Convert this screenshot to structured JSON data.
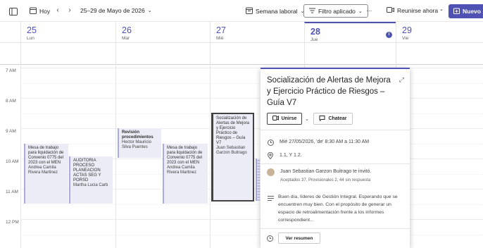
{
  "toolbar": {
    "today_label": "Hoy",
    "date_range": "25–29 de Mayo de 2026",
    "view_label": "Semana laboral",
    "filter_label": "Filtro aplicado",
    "more_label": "···",
    "meet_now_label": "Reunirse ahora",
    "new_label": "Nuevo"
  },
  "days": [
    {
      "num": "25",
      "name": "Lun"
    },
    {
      "num": "26",
      "name": "Mar"
    },
    {
      "num": "27",
      "name": "Mié"
    },
    {
      "num": "28",
      "name": "Jue"
    },
    {
      "num": "29",
      "name": "Vie"
    }
  ],
  "hours": [
    "7 AM",
    "8 AM",
    "9 AM",
    "10 AM",
    "11 AM",
    "12 PM"
  ],
  "events": {
    "mon1": {
      "title": "Mesa de trabajo para liquidación de Convenio 0775 del 2023 con el MEN",
      "people": "Andrea Camila Rivera Martinez"
    },
    "mon2": {
      "title": "AUDITORIA PROCESO PLANEACION ACTAS SEG Y PORSD",
      "people": "Martha Lucia Carb"
    },
    "tue1": {
      "title": "Revisión procedimientos",
      "people": "Hector Mauricio Silva Puentes"
    },
    "tue2": {
      "title": "Mesa de trabajo para liquidación de Convenio 0775 del 2023 con el MEN",
      "people": "Andrea Camila Rivera Martinez"
    },
    "wed1": {
      "title": "Socialización de Alertas de Mejora y Ejercicio Práctico de Riesgos – Guía V7",
      "people": "Juan Sebastian Garzon Buitrago"
    }
  },
  "popup": {
    "title": "Socialización de Alertas de Mejora y Ejercicio Práctico de Riesgos – Guía V7",
    "join_label": "Unirse",
    "chat_label": "Chatear",
    "time": "Mié 27/05/2026, 'de' 8:30 AM a 11:30 AM",
    "location": "1.1, Y 1.2.",
    "organizer": "Juan Sebastian Garzon Buitrago te invitó.",
    "responses": "Aceptados 37, Provisionales 2, 44 sin respuesta",
    "description": "Buen día, líderes de Gestión Integral. Esperando que se encuentren muy bien. Con el propósito de generar un espacio de retroalimentación frente a los informes correspondient...",
    "summary_label": "Ver resumen"
  },
  "colors": {
    "accent": "#4f52b2",
    "event_bg": "#ebecf6"
  }
}
